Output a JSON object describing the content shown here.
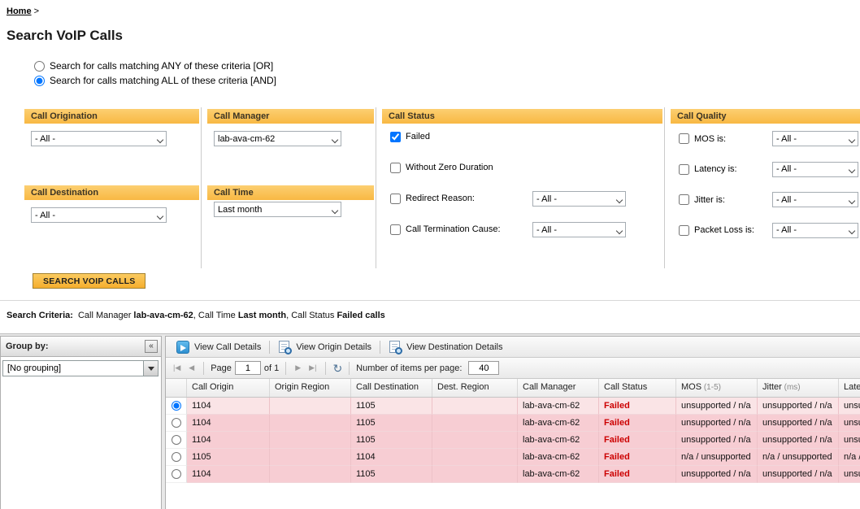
{
  "breadcrumb": {
    "home": "Home",
    "separator": ">"
  },
  "page_title": "Search VoIP Calls",
  "match_options": [
    {
      "label": "Search for calls matching ANY of these criteria [OR]",
      "selected": false
    },
    {
      "label": "Search for calls matching ALL of these criteria [AND]",
      "selected": true
    }
  ],
  "panels": {
    "call_origination": {
      "title": "Call Origination",
      "selected_value": "- All -"
    },
    "call_manager": {
      "title": "Call Manager",
      "selected_value": "lab-ava-cm-62"
    },
    "call_destination": {
      "title": "Call Destination",
      "selected_value": "- All -"
    },
    "call_time": {
      "title": "Call Time",
      "selected_value": "Last month"
    },
    "call_status": {
      "title": "Call Status",
      "failed_label": "Failed",
      "failed_checked": true,
      "without_zero_label": "Without Zero Duration",
      "redirect_label": "Redirect Reason:",
      "redirect_value": "- All -",
      "termination_label": "Call Termination Cause:",
      "termination_value": "- All -"
    },
    "call_quality": {
      "title": "Call Quality",
      "rows": [
        {
          "label": "MOS is:",
          "value": "- All -",
          "checked": false
        },
        {
          "label": "Latency is:",
          "value": "- All -",
          "checked": false
        },
        {
          "label": "Jitter is:",
          "value": "- All -",
          "checked": false
        },
        {
          "label": "Packet Loss is:",
          "value": "- All -",
          "checked": false
        }
      ]
    }
  },
  "search_button_label": "SEARCH VOIP CALLS",
  "search_criteria": {
    "label": "Search Criteria:",
    "segments": [
      {
        "text": "Call Manager ",
        "bold": false
      },
      {
        "text": "lab-ava-cm-62",
        "bold": true
      },
      {
        "text": ", Call Time ",
        "bold": false
      },
      {
        "text": "Last month",
        "bold": true
      },
      {
        "text": ", Call Status ",
        "bold": false
      },
      {
        "text": "Failed calls",
        "bold": true
      }
    ]
  },
  "group_by": {
    "title": "Group by:",
    "collapse_glyph": "«",
    "value": "[No grouping]"
  },
  "grid": {
    "toolbar": [
      {
        "label": "View Call Details",
        "icon": "call-details-icon"
      },
      {
        "label": "View Origin Details",
        "icon": "origin-details-icon"
      },
      {
        "label": "View Destination Details",
        "icon": "destination-details-icon"
      }
    ],
    "pagination": {
      "first_glyph": "|◀",
      "prev_glyph": "◀",
      "next_glyph": "▶",
      "last_glyph": "▶|",
      "refresh_glyph": "↻",
      "page_label": "Page",
      "page_value": "1",
      "of_label": "of 1",
      "items_label": "Number of items per page:",
      "items_value": "40"
    },
    "columns": [
      {
        "label": "Call Origin",
        "unit": ""
      },
      {
        "label": "Origin Region",
        "unit": ""
      },
      {
        "label": "Call Destination",
        "unit": ""
      },
      {
        "label": "Dest. Region",
        "unit": ""
      },
      {
        "label": "Call Manager",
        "unit": ""
      },
      {
        "label": "Call Status",
        "unit": ""
      },
      {
        "label": "MOS",
        "unit": "(1-5)"
      },
      {
        "label": "Jitter",
        "unit": "(ms)"
      },
      {
        "label": "Latency",
        "unit": ""
      }
    ],
    "rows": [
      {
        "selected": true,
        "call_origin": "1104",
        "origin_region": "",
        "call_destination": "1105",
        "dest_region": "",
        "call_manager": "lab-ava-cm-62",
        "call_status": "Failed",
        "mos": "unsupported / n/a",
        "jitter": "unsupported / n/a",
        "latency": "unsupported / n/a"
      },
      {
        "selected": false,
        "call_origin": "1104",
        "origin_region": "",
        "call_destination": "1105",
        "dest_region": "",
        "call_manager": "lab-ava-cm-62",
        "call_status": "Failed",
        "mos": "unsupported / n/a",
        "jitter": "unsupported / n/a",
        "latency": "unsupported / n/a"
      },
      {
        "selected": false,
        "call_origin": "1104",
        "origin_region": "",
        "call_destination": "1105",
        "dest_region": "",
        "call_manager": "lab-ava-cm-62",
        "call_status": "Failed",
        "mos": "unsupported / n/a",
        "jitter": "unsupported / n/a",
        "latency": "unsupported / n/a"
      },
      {
        "selected": false,
        "call_origin": "1105",
        "origin_region": "",
        "call_destination": "1104",
        "dest_region": "",
        "call_manager": "lab-ava-cm-62",
        "call_status": "Failed",
        "mos": "n/a / unsupported",
        "jitter": "n/a / unsupported",
        "latency": "n/a / unsupported"
      },
      {
        "selected": false,
        "call_origin": "1104",
        "origin_region": "",
        "call_destination": "1105",
        "dest_region": "",
        "call_manager": "lab-ava-cm-62",
        "call_status": "Failed",
        "mos": "unsupported / n/a",
        "jitter": "unsupported / n/a",
        "latency": "unsupported / n/a"
      }
    ]
  },
  "colors": {
    "panel_header_orange": "#F8B843",
    "failed_text_red": "#CC0000",
    "failed_row_pink": "#F7CDD3",
    "selected_row_pink": "#FAE4E6",
    "toolbar_icon_blue": "#2E8FD0"
  }
}
